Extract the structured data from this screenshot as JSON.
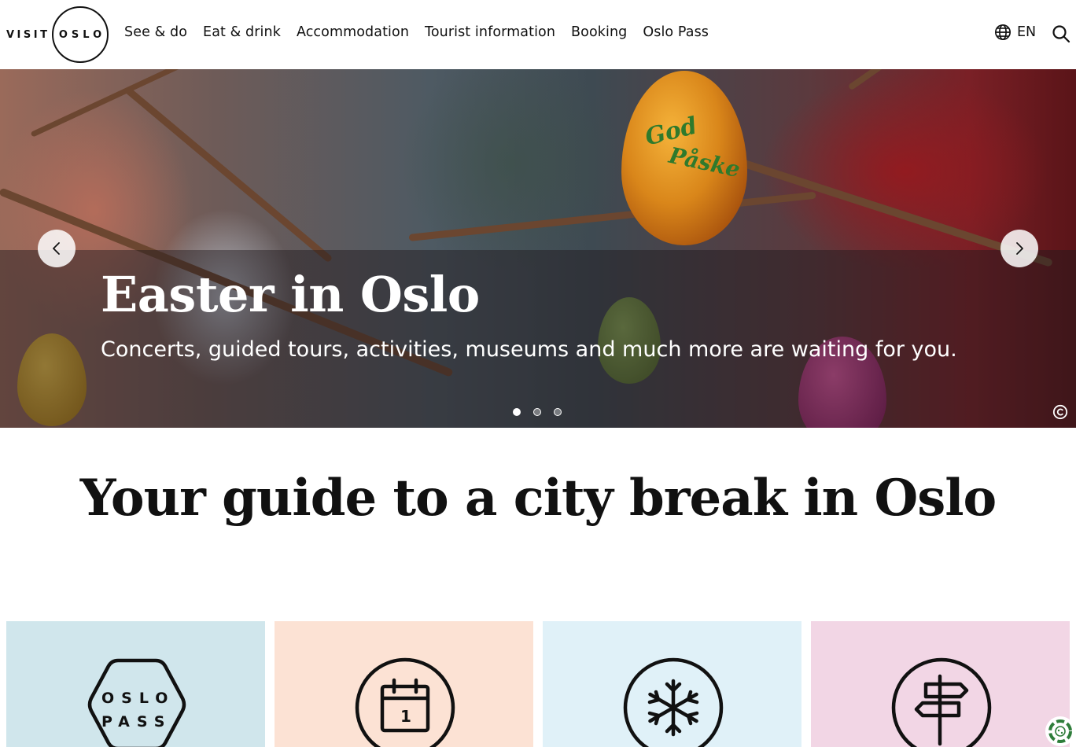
{
  "header": {
    "logo_visit": "VISIT",
    "logo_oslo": "OSLO",
    "nav": [
      "See & do",
      "Eat & drink",
      "Accommodation",
      "Tourist information",
      "Booking",
      "Oslo Pass"
    ],
    "language": "EN",
    "icons": {
      "language": "globe-icon",
      "search": "search-icon"
    }
  },
  "hero": {
    "title": "Easter in Oslo",
    "subtitle": "Concerts, guided tours, activities, museums and much more are waiting for you.",
    "slide_count": 3,
    "active_slide": 1,
    "image_text": [
      "God",
      "Påske"
    ],
    "icons": {
      "prev": "chevron-left-icon",
      "next": "chevron-right-icon",
      "copyright": "copyright-icon"
    }
  },
  "guide": {
    "title": "Your guide to a city break in Oslo"
  },
  "cards": [
    {
      "icon": "oslo-pass-icon",
      "icon_text": [
        "OSLO",
        "PASS"
      ],
      "color": "#d0e6ec"
    },
    {
      "icon": "calendar-icon",
      "icon_text": [
        "1"
      ],
      "color": "#fce2d4"
    },
    {
      "icon": "snowflake-icon",
      "color": "#e0f1f8"
    },
    {
      "icon": "signpost-icon",
      "color": "#f2d6e5"
    }
  ],
  "cookie_widget": {
    "icon": "cookie-settings-icon",
    "color": "#2e7d3a"
  }
}
